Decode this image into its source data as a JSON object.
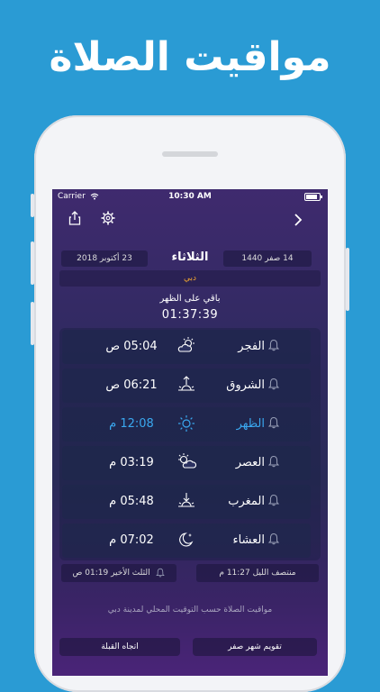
{
  "headline": "مواقيت الصلاة",
  "status": {
    "carrier": "Carrier",
    "time": "10:30 AM"
  },
  "dates": {
    "gregorian": "23 أكتوبر 2018",
    "day": "الثلاثاء",
    "hijri": "14 صفر 1440"
  },
  "city": "دبي",
  "remaining": {
    "label": "باقي على الظهر",
    "time": "01:37:39"
  },
  "prayers": [
    {
      "name": "الفجر",
      "time": "05:04 ص",
      "icon": "cloud-sun-icon",
      "active": false
    },
    {
      "name": "الشروق",
      "time": "06:21 ص",
      "icon": "sunrise-icon",
      "active": false
    },
    {
      "name": "الظهر",
      "time": "12:08 م",
      "icon": "sun-icon",
      "active": true
    },
    {
      "name": "العصر",
      "time": "03:19 م",
      "icon": "sun-cloud-icon",
      "active": false
    },
    {
      "name": "المغرب",
      "time": "05:48 م",
      "icon": "sunset-icon",
      "active": false
    },
    {
      "name": "العشاء",
      "time": "07:02 م",
      "icon": "moon-star-icon",
      "active": false
    }
  ],
  "night": {
    "midnight": "منتصف الليل 11:27 م",
    "last_third": "الثلث الأخير 01:19 ص"
  },
  "footnote": "مواقيت الصلاة حسب التوقيت المحلي لمدينة دبي",
  "buttons": {
    "qibla": "اتجاه القبلة",
    "calendar": "تقويم شهر صفر"
  },
  "colors": {
    "accent": "#3aa8f0",
    "city": "#f0a630",
    "background": "#2a9bd4"
  }
}
